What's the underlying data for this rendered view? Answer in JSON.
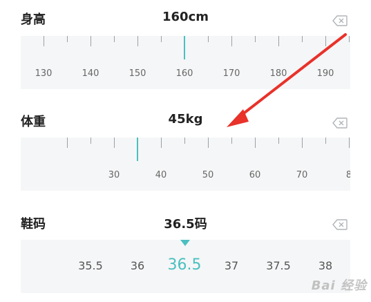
{
  "height": {
    "label": "身高",
    "value": "160cm",
    "selected": 160,
    "tick_labels": [
      "130",
      "140",
      "150",
      "160",
      "170",
      "180",
      "190"
    ]
  },
  "weight": {
    "label": "体重",
    "value": "45kg",
    "selected": 45,
    "tick_labels": [
      "30",
      "40",
      "50",
      "60",
      "70",
      "8"
    ]
  },
  "shoe": {
    "label": "鞋码",
    "value": "36.5码",
    "selected": "36.5",
    "options": [
      "35.5",
      "36",
      "36.5",
      "37",
      "37.5",
      "38"
    ]
  },
  "icons": {
    "clear": "backspace-icon",
    "annotation": "red-arrow"
  },
  "colors": {
    "accent": "#4bbfc0",
    "arrow": "#e8322a",
    "ruler_bg": "#f5f6f7"
  },
  "watermark": "Bai 经验"
}
